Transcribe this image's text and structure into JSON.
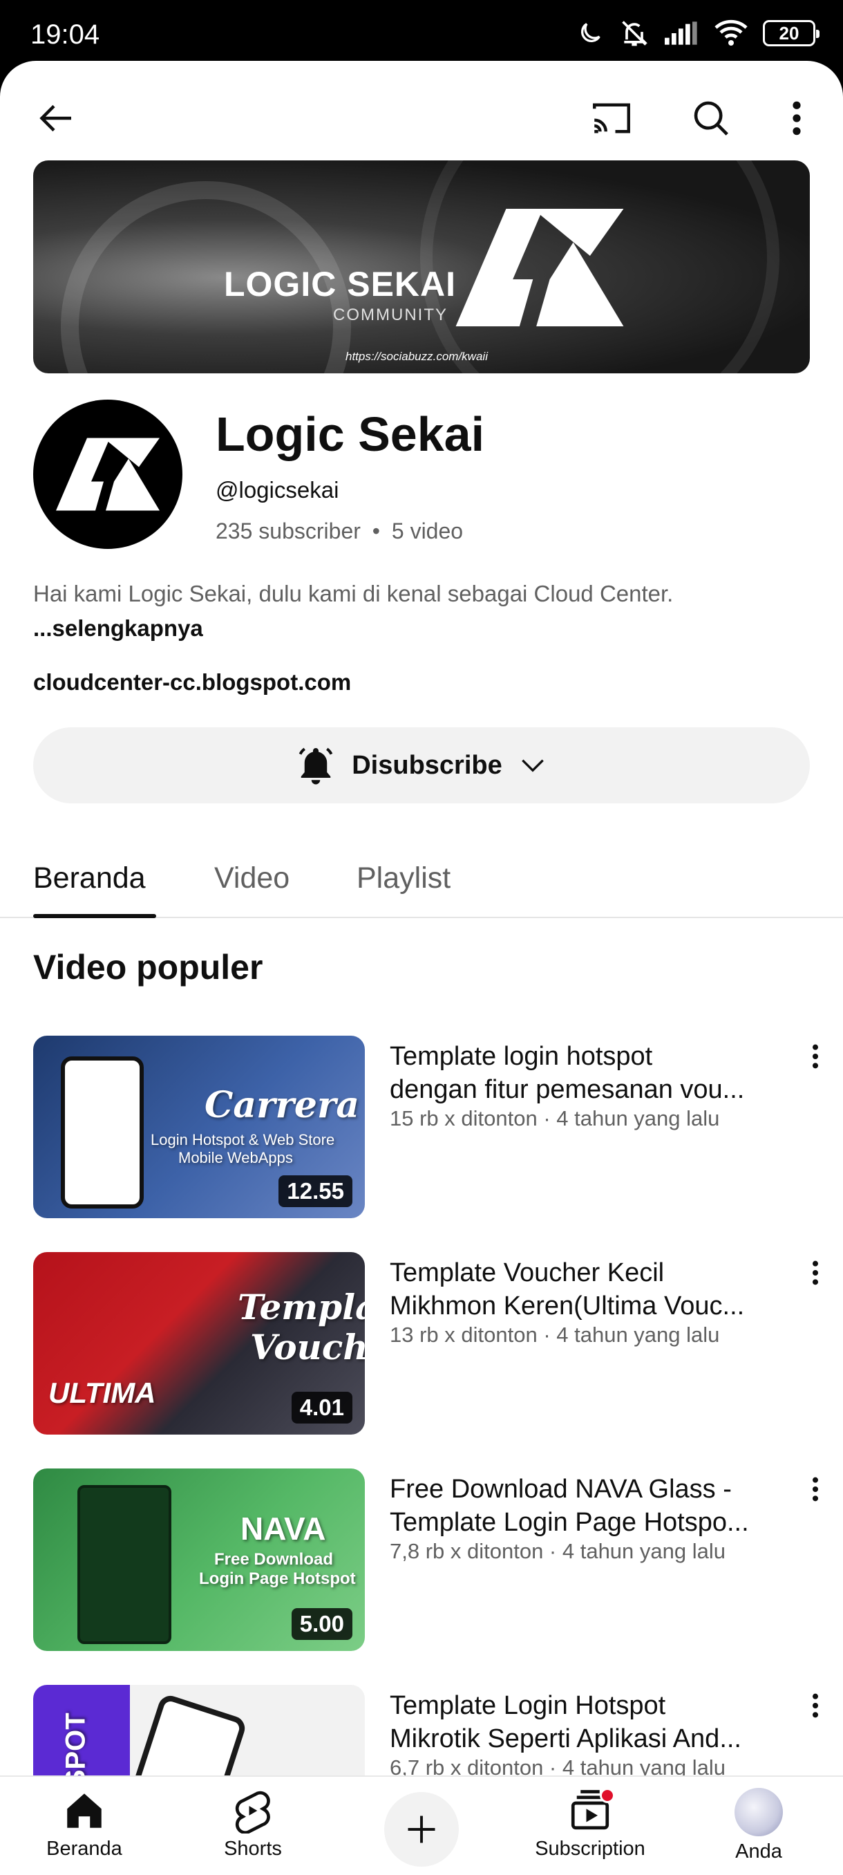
{
  "status": {
    "time": "19:04",
    "battery": "20"
  },
  "banner": {
    "title": "LOGIC SEKAI",
    "subtitle": "COMMUNITY",
    "url": "https://sociabuzz.com/kwaii"
  },
  "channel": {
    "name": "Logic Sekai",
    "handle": "@logicsekai",
    "subscribers": "235 subscriber",
    "separator": "•",
    "video_count": "5 video",
    "description": "Hai kami Logic Sekai, dulu kami di kenal sebagai Cloud Center.",
    "description_more": "...selengkapnya",
    "link": "cloudcenter-cc.blogspot.com",
    "subscribe_label": "Disubscribe"
  },
  "tabs": [
    {
      "label": "Beranda",
      "active": true
    },
    {
      "label": "Video",
      "active": false
    },
    {
      "label": "Playlist",
      "active": false
    }
  ],
  "section_title": "Video populer",
  "videos": [
    {
      "title_line1": "Template login hotspot",
      "title_line2": "dengan fitur pemesanan vou...",
      "meta": "15 rb x ditonton · 4 tahun yang lalu",
      "duration": "12.55",
      "thumb_text": "Carrera",
      "thumb_sub": "Login Hotspot & Web Store",
      "thumb_sub2": "Mobile WebApps"
    },
    {
      "title_line1": "Template Voucher Kecil",
      "title_line2": "Mikhmon Keren(Ultima Vouc...",
      "meta": "13 rb x ditonton · 4 tahun yang lalu",
      "duration": "4.01",
      "thumb_text": "Template",
      "thumb_sub": "Voucher",
      "thumb_sub2": "ULTIMA"
    },
    {
      "title_line1": "Free Download NAVA Glass -",
      "title_line2": "Template Login Page Hotspo...",
      "meta": "7,8 rb x ditonton · 4 tahun yang lalu",
      "duration": "5.00",
      "thumb_text": "NAVA",
      "thumb_sub": "Free Download",
      "thumb_sub2": "Login Page Hotspot"
    },
    {
      "title_line1": "Template Login Hotspot",
      "title_line2": "Mikrotik Seperti Aplikasi And...",
      "meta": "6,7 rb x ditonton · 4 tahun yang lalu",
      "duration": "",
      "thumb_text": "OTSPOT",
      "thumb_sub": "",
      "thumb_sub2": ""
    }
  ],
  "bottom_nav": [
    {
      "label": "Beranda",
      "icon": "home-icon"
    },
    {
      "label": "Shorts",
      "icon": "shorts-icon"
    },
    {
      "label": "",
      "icon": "create-icon"
    },
    {
      "label": "Subscription",
      "icon": "subscriptions-icon"
    },
    {
      "label": "Anda",
      "icon": "avatar"
    }
  ],
  "colors": {
    "text_primary": "#0f0f0f",
    "text_secondary": "#606060",
    "chip_bg": "#f2f2f2",
    "notification_dot": "#e0102b"
  }
}
